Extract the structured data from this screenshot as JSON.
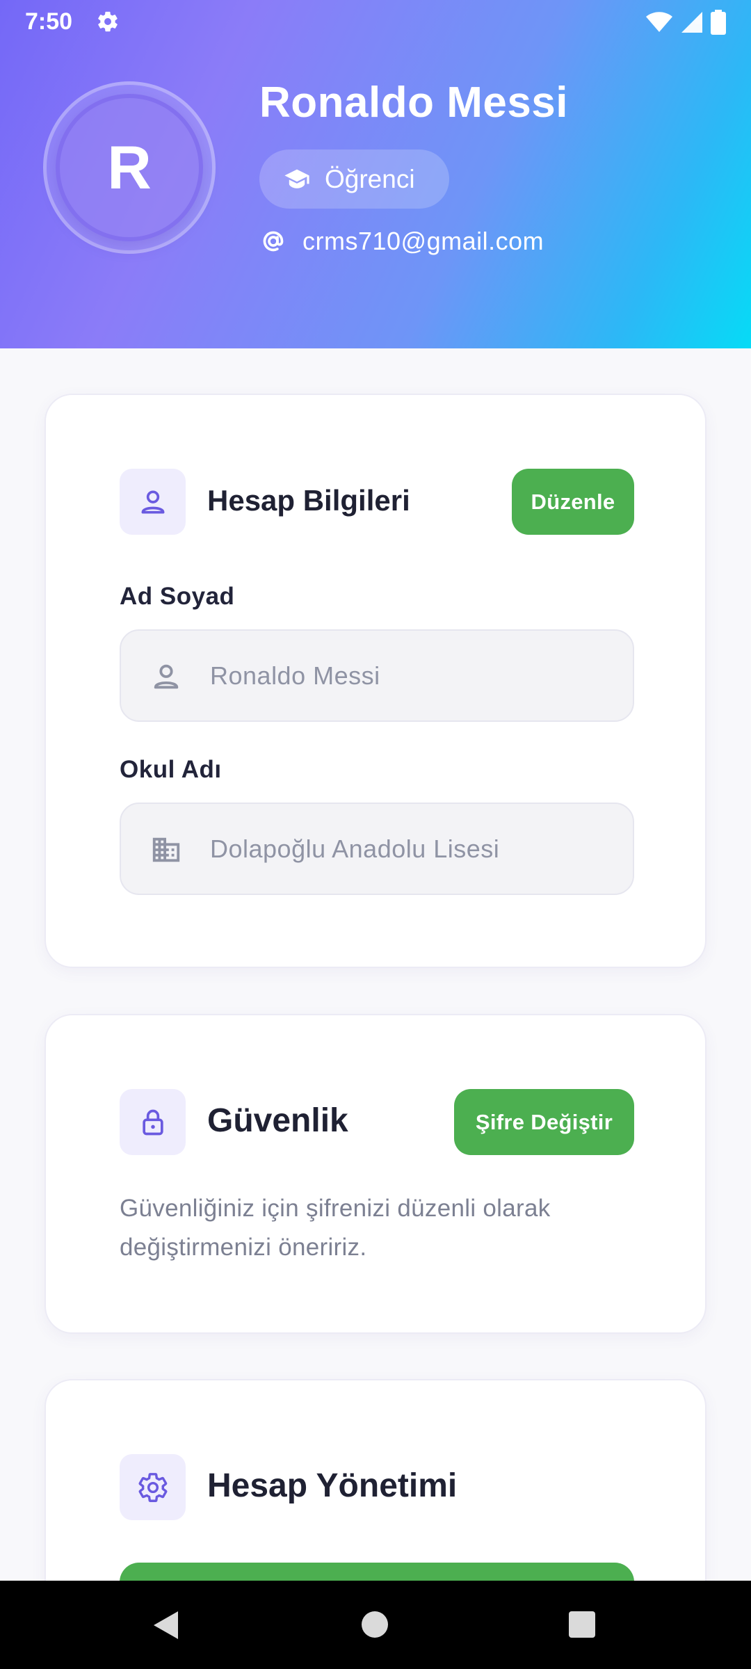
{
  "status_bar": {
    "time": "7:50",
    "gear_icon": "gear-icon",
    "wifi_icon": "wifi-icon",
    "signal_icon": "signal-icon",
    "battery_icon": "battery-icon"
  },
  "profile": {
    "avatar_initial": "R",
    "name": "Ronaldo Messi",
    "role": "Öğrenci",
    "role_icon": "graduation-cap-icon",
    "email": "crms710@gmail.com",
    "email_icon": "at-icon"
  },
  "account_info": {
    "icon": "person-icon",
    "title": "Hesap Bilgileri",
    "edit_label": "Düzenle",
    "fields": [
      {
        "label": "Ad Soyad",
        "value": "Ronaldo Messi",
        "icon": "person-icon"
      },
      {
        "label": "Okul Adı",
        "value": "Dolapoğlu Anadolu Lisesi",
        "icon": "building-icon"
      }
    ]
  },
  "security": {
    "icon": "lock-icon",
    "title": "Güvenlik",
    "change_password_label": "Şifre Değiştir",
    "description": "Güvenliğiniz için şifrenizi düzenli olarak değiştirmenizi öneririz."
  },
  "account_management": {
    "icon": "gear-icon",
    "title": "Hesap Yönetimi"
  },
  "colors": {
    "accent": "#6A5AE0",
    "button_green": "#4CAF50",
    "header_gradient_start": "#7468F7",
    "header_gradient_end": "#06DBF6"
  },
  "nav": {
    "back_icon": "back-triangle-icon",
    "home_icon": "home-circle-icon",
    "recents_icon": "recents-square-icon"
  }
}
